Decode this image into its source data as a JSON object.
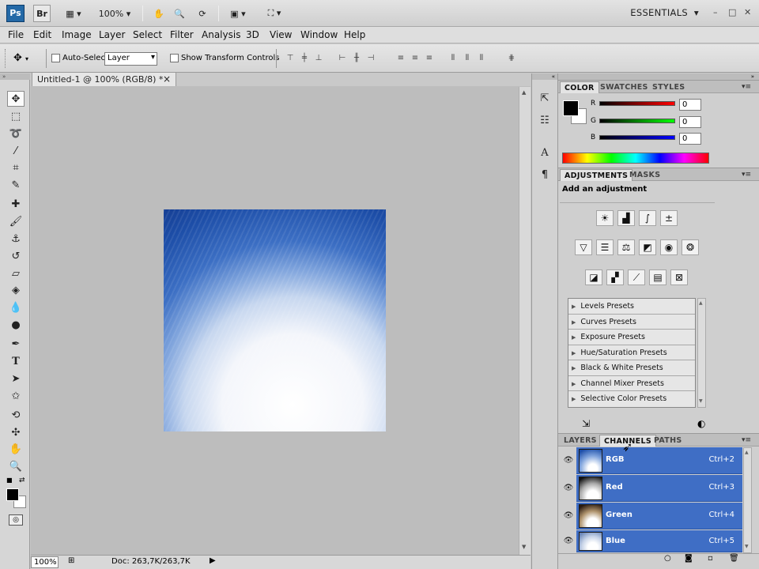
{
  "appbar": {
    "logo": "Ps",
    "bridge": "Br",
    "zoom": "100%",
    "workspace": "ESSENTIALS",
    "window_controls": [
      "–",
      "□",
      "✕"
    ]
  },
  "menu": [
    "File",
    "Edit",
    "Image",
    "Layer",
    "Select",
    "Filter",
    "Analysis",
    "3D",
    "View",
    "Window",
    "Help"
  ],
  "options": {
    "auto_select_label": "Auto-Select:",
    "auto_select_value": "Layer",
    "show_transform_label": "Show Transform Controls"
  },
  "document": {
    "tab_title": "Untitled-1 @ 100% (RGB/8) *",
    "close_glyph": "×",
    "status_zoom": "100%",
    "status_doc": "Doc: 263,7K/263,7K"
  },
  "color_panel": {
    "tabs": [
      "COLOR",
      "SWATCHES",
      "STYLES"
    ],
    "channels": [
      {
        "label": "R",
        "value": "0"
      },
      {
        "label": "G",
        "value": "0"
      },
      {
        "label": "B",
        "value": "0"
      }
    ]
  },
  "adjustments_panel": {
    "tabs": [
      "ADJUSTMENTS",
      "MASKS"
    ],
    "heading": "Add an adjustment",
    "presets": [
      "Levels Presets",
      "Curves Presets",
      "Exposure Presets",
      "Hue/Saturation Presets",
      "Black & White Presets",
      "Channel Mixer Presets",
      "Selective Color Presets"
    ]
  },
  "layers_panel": {
    "tabs": [
      "LAYERS",
      "CHANNELS",
      "PATHS"
    ],
    "channels": [
      {
        "name": "RGB",
        "shortcut": "Ctrl+2"
      },
      {
        "name": "Red",
        "shortcut": "Ctrl+3"
      },
      {
        "name": "Green",
        "shortcut": "Ctrl+4"
      },
      {
        "name": "Blue",
        "shortcut": "Ctrl+5"
      }
    ]
  },
  "colors": {
    "accent_selection": "#3f6ec5",
    "logo_blue": "#2469a7"
  }
}
